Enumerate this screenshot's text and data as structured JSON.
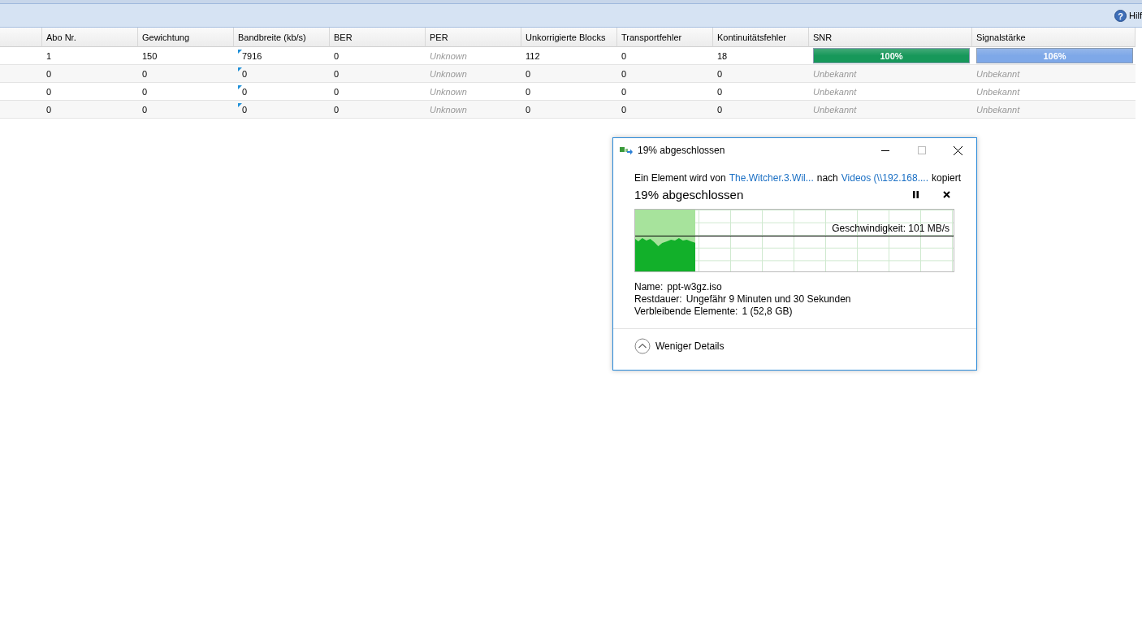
{
  "toolbar": {
    "help_icon": "?",
    "help_label": "Hilf"
  },
  "table": {
    "columns": [
      "",
      "Abo Nr.",
      "Gewichtung",
      "Bandbreite (kb/s)",
      "BER",
      "PER",
      "Unkorrigierte Blocks",
      "Transportfehler",
      "Kontinuitätsfehler",
      "SNR",
      "Signalstärke"
    ],
    "rows": [
      {
        "cells": [
          {
            "kind": "text",
            "text": ""
          },
          {
            "kind": "text",
            "text": "1"
          },
          {
            "kind": "text",
            "text": "150"
          },
          {
            "kind": "flagged",
            "text": "7916"
          },
          {
            "kind": "text",
            "text": "0"
          },
          {
            "kind": "muted",
            "text": "Unknown"
          },
          {
            "kind": "text",
            "text": "112"
          },
          {
            "kind": "text",
            "text": "0"
          },
          {
            "kind": "text",
            "text": "18"
          },
          {
            "kind": "bar",
            "text": "100%",
            "level": 1,
            "color": "#17985a"
          },
          {
            "kind": "bar",
            "text": "106%",
            "level": 1,
            "color": "#7ea8e8"
          }
        ]
      },
      {
        "cells": [
          {
            "kind": "text",
            "text": ""
          },
          {
            "kind": "text",
            "text": "0"
          },
          {
            "kind": "text",
            "text": "0"
          },
          {
            "kind": "flagged",
            "text": "0"
          },
          {
            "kind": "text",
            "text": "0"
          },
          {
            "kind": "muted",
            "text": "Unknown"
          },
          {
            "kind": "text",
            "text": "0"
          },
          {
            "kind": "text",
            "text": "0"
          },
          {
            "kind": "text",
            "text": "0"
          },
          {
            "kind": "muted",
            "text": "Unbekannt"
          },
          {
            "kind": "muted",
            "text": "Unbekannt"
          }
        ]
      },
      {
        "cells": [
          {
            "kind": "text",
            "text": ""
          },
          {
            "kind": "text",
            "text": "0"
          },
          {
            "kind": "text",
            "text": "0"
          },
          {
            "kind": "flagged",
            "text": "0"
          },
          {
            "kind": "text",
            "text": "0"
          },
          {
            "kind": "muted",
            "text": "Unknown"
          },
          {
            "kind": "text",
            "text": "0"
          },
          {
            "kind": "text",
            "text": "0"
          },
          {
            "kind": "text",
            "text": "0"
          },
          {
            "kind": "muted",
            "text": "Unbekannt"
          },
          {
            "kind": "muted",
            "text": "Unbekannt"
          }
        ]
      },
      {
        "cells": [
          {
            "kind": "text",
            "text": ""
          },
          {
            "kind": "text",
            "text": "0"
          },
          {
            "kind": "text",
            "text": "0"
          },
          {
            "kind": "flagged",
            "text": "0"
          },
          {
            "kind": "text",
            "text": "0"
          },
          {
            "kind": "muted",
            "text": "Unknown"
          },
          {
            "kind": "text",
            "text": "0"
          },
          {
            "kind": "text",
            "text": "0"
          },
          {
            "kind": "text",
            "text": "0"
          },
          {
            "kind": "muted",
            "text": "Unbekannt"
          },
          {
            "kind": "muted",
            "text": "Unbekannt"
          }
        ]
      }
    ]
  },
  "copy_dialog": {
    "title": "19% abgeschlossen",
    "description": [
      {
        "kind": "text",
        "text": "Ein Element wird von"
      },
      {
        "kind": "link",
        "text": "The.Witcher.3.Wil..."
      },
      {
        "kind": "text",
        "text": "nach"
      },
      {
        "kind": "link",
        "text": "Videos (\\\\192.168...."
      },
      {
        "kind": "text",
        "text": "kopiert"
      }
    ],
    "heading": "19% abgeschlossen",
    "progress": {
      "level": 0.19,
      "speed": "Geschwindigkeit: 101 MB/s"
    },
    "details": [
      {
        "label": "Name:",
        "value": "ppt-w3gz.iso"
      },
      {
        "label": "Restdauer:",
        "value": "Ungefähr 9 Minuten und 30 Sekunden"
      },
      {
        "label": "Verbleibende Elemente:",
        "value": "1 (52,8 GB)"
      }
    ],
    "toggle_label": "Weniger Details",
    "expanded": true
  }
}
